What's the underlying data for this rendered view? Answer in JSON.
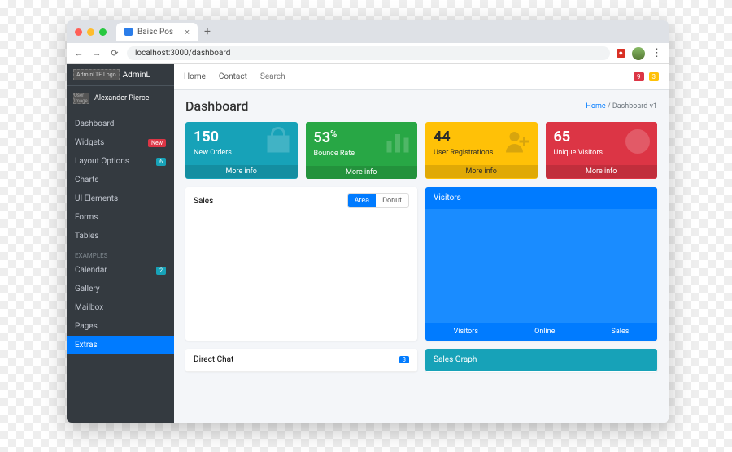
{
  "browser": {
    "tab_title": "Baisc Pos",
    "url": "localhost:3000/dashboard",
    "notif_red": "9",
    "notif_yellow": "3"
  },
  "brand": {
    "logo_alt": "AdminLTE Logo",
    "text": "AdminL"
  },
  "user": {
    "img_alt": "User Image",
    "name": "Alexander Pierce"
  },
  "sidebar": {
    "items": [
      {
        "label": "Dashboard",
        "badge": ""
      },
      {
        "label": "Widgets",
        "badge": "New",
        "badge_class": "new"
      },
      {
        "label": "Layout Options",
        "badge": "6",
        "badge_class": "cnt"
      },
      {
        "label": "Charts",
        "badge": ""
      },
      {
        "label": "UI Elements",
        "badge": ""
      },
      {
        "label": "Forms",
        "badge": ""
      },
      {
        "label": "Tables",
        "badge": ""
      }
    ],
    "section_header": "EXAMPLES",
    "examples": [
      {
        "label": "Calendar",
        "badge": "2",
        "badge_class": "cnt"
      },
      {
        "label": "Gallery",
        "badge": ""
      },
      {
        "label": "Mailbox",
        "badge": ""
      },
      {
        "label": "Pages",
        "badge": ""
      },
      {
        "label": "Extras",
        "badge": "",
        "active": true
      }
    ]
  },
  "topbar": {
    "home": "Home",
    "contact": "Contact",
    "search_placeholder": "Search"
  },
  "page": {
    "title": "Dashboard",
    "crumb_home": "Home",
    "crumb_current": "Dashboard v1"
  },
  "stats": [
    {
      "value": "150",
      "suffix": "",
      "label": "New Orders",
      "more": "More info",
      "color": "teal",
      "icon": "bag"
    },
    {
      "value": "53",
      "suffix": "%",
      "label": "Bounce Rate",
      "more": "More info",
      "color": "green",
      "icon": "bars"
    },
    {
      "value": "44",
      "suffix": "",
      "label": "User Registrations",
      "more": "More info",
      "color": "yellow",
      "icon": "user-add"
    },
    {
      "value": "65",
      "suffix": "",
      "label": "Unique Visitors",
      "more": "More info",
      "color": "red",
      "icon": "pie"
    }
  ],
  "sales_card": {
    "title": "Sales",
    "tab_area": "Area",
    "tab_donut": "Donut"
  },
  "visitors_card": {
    "title": "Visitors",
    "ft1": "Visitors",
    "ft2": "Online",
    "ft3": "Sales"
  },
  "direct_chat": {
    "title": "Direct Chat",
    "count": "3"
  },
  "sales_graph": {
    "title": "Sales Graph"
  }
}
